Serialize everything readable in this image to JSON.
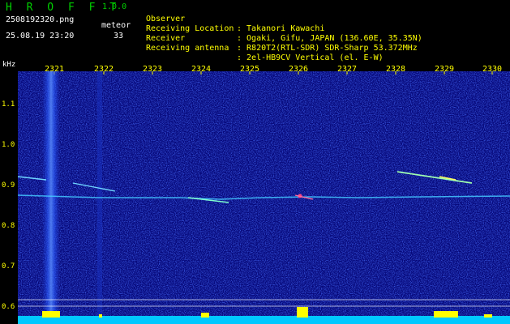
{
  "app": {
    "name": "H R O F F T",
    "version": "1.0.0"
  },
  "file": {
    "name": "2508192320.png",
    "datetime": "25.08.19 23:20"
  },
  "meteor": {
    "label": "meteor",
    "count": "33"
  },
  "header": {
    "rows": [
      {
        "label": "Observer",
        "value": ": Takanori Kawachi"
      },
      {
        "label": "Receiving Location",
        "value": ": Ogaki, Gifu, JAPAN (136.60E, 35.35N)"
      },
      {
        "label": "Receiver",
        "value": ": R820T2(RTL-SDR) SDR-Sharp 53.372MHz"
      },
      {
        "label": "Receiving antenna",
        "value": ": 2el-HB9CV Vertical (el. E-W)"
      }
    ]
  },
  "axis": {
    "unit": "kHz",
    "x_ticks": [
      "2321",
      "2322",
      "2323",
      "2324",
      "2325",
      "2326",
      "2327",
      "2328",
      "2329",
      "2330"
    ],
    "y_ticks": [
      "1.1",
      "1.0",
      "0.9",
      "0.8",
      "0.7",
      "0.6"
    ]
  },
  "colors": {
    "background": "#050a6e",
    "noise": "#1a2fd0",
    "trace": "#30c8ff",
    "yellow": "#ffff00"
  }
}
